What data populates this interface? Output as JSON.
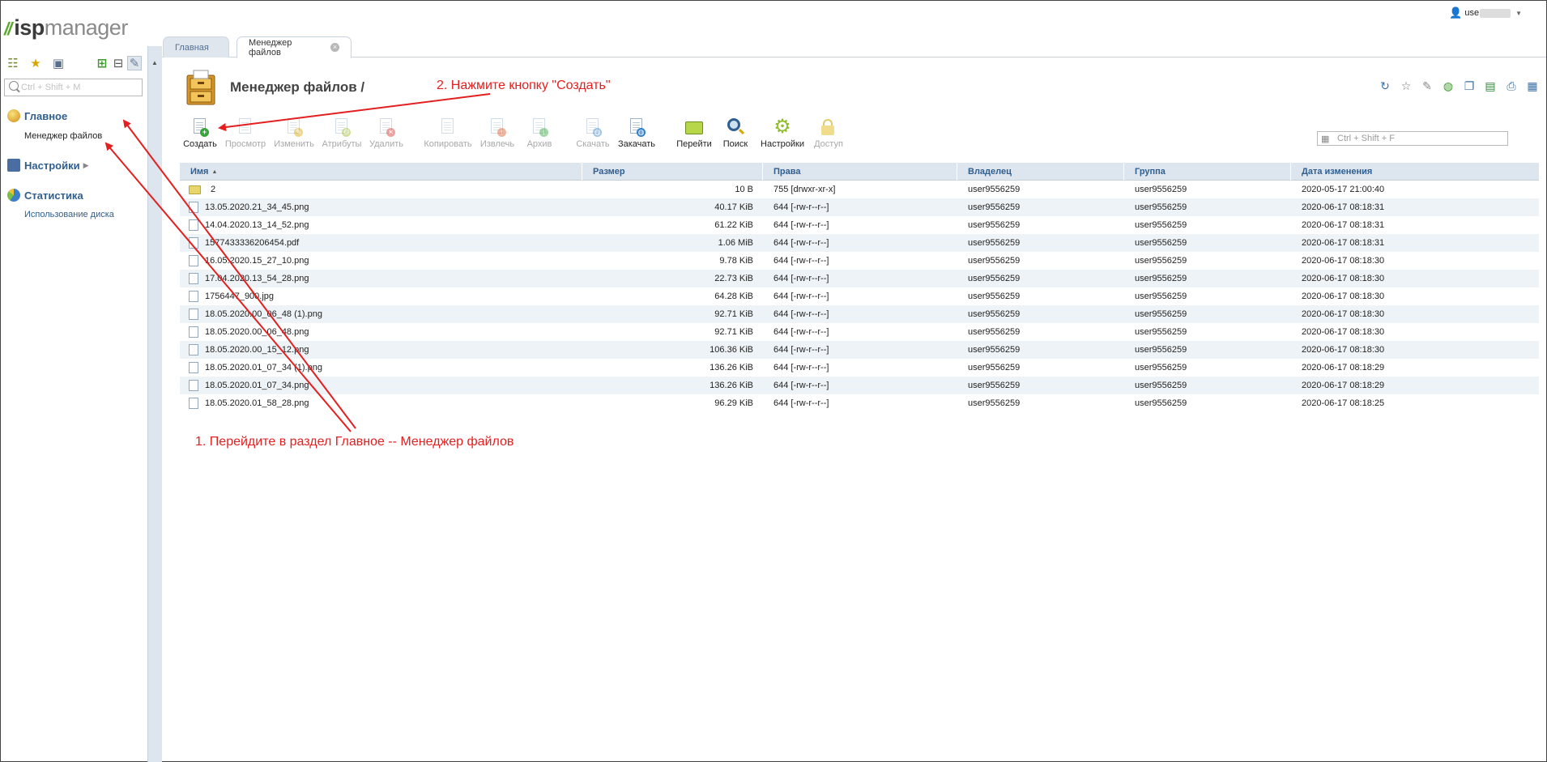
{
  "brand": {
    "slash": "//",
    "isp": "isp",
    "manager": "manager"
  },
  "sidebar": {
    "search_placeholder": "Ctrl + Shift + M",
    "groups": [
      {
        "label": "Главное",
        "items": [
          "Менеджер файлов"
        ]
      },
      {
        "label": "Настройки",
        "items": []
      },
      {
        "label": "Статистика",
        "items": [
          "Использование диска"
        ]
      }
    ]
  },
  "tabs": [
    {
      "label": "Главная"
    },
    {
      "label": "Менеджер файлов"
    }
  ],
  "user": {
    "name": "use"
  },
  "page": {
    "title": "Менеджер файлов /"
  },
  "filter": {
    "placeholder": "Ctrl + Shift + F"
  },
  "toolbar": [
    {
      "label": "Создать",
      "enabled": true,
      "icon": "create-icon"
    },
    {
      "label": "Просмотр",
      "enabled": false,
      "icon": "view-icon"
    },
    {
      "label": "Изменить",
      "enabled": false,
      "icon": "edit-icon"
    },
    {
      "label": "Атрибуты",
      "enabled": false,
      "icon": "attributes-icon"
    },
    {
      "label": "Удалить",
      "enabled": false,
      "icon": "delete-icon"
    },
    {
      "label": "Копировать",
      "enabled": false,
      "icon": "copy-icon"
    },
    {
      "label": "Извлечь",
      "enabled": false,
      "icon": "extract-icon"
    },
    {
      "label": "Архив",
      "enabled": false,
      "icon": "archive-icon"
    },
    {
      "label": "Скачать",
      "enabled": false,
      "icon": "download-icon"
    },
    {
      "label": "Закачать",
      "enabled": true,
      "icon": "upload-icon"
    },
    {
      "label": "Перейти",
      "enabled": true,
      "icon": "folder-go-icon"
    },
    {
      "label": "Поиск",
      "enabled": true,
      "icon": "search-icon"
    },
    {
      "label": "Настройки",
      "enabled": true,
      "icon": "gear-icon"
    },
    {
      "label": "Доступ",
      "enabled": false,
      "icon": "lock-icon"
    }
  ],
  "table": {
    "columns": [
      "Имя",
      "Размер",
      "Права",
      "Владелец",
      "Группа",
      "Дата изменения"
    ],
    "rows": [
      {
        "name": "2",
        "type": "folder",
        "size": "10 B",
        "perm": "755 [drwxr-xr-x]",
        "owner": "user9556259",
        "group": "user9556259",
        "date": "2020-05-17 21:00:40"
      },
      {
        "name": "13.05.2020.21_34_45.png",
        "type": "file",
        "size": "40.17 KiB",
        "perm": "644 [-rw-r--r--]",
        "owner": "user9556259",
        "group": "user9556259",
        "date": "2020-06-17 08:18:31"
      },
      {
        "name": "14.04.2020.13_14_52.png",
        "type": "file",
        "size": "61.22 KiB",
        "perm": "644 [-rw-r--r--]",
        "owner": "user9556259",
        "group": "user9556259",
        "date": "2020-06-17 08:18:31"
      },
      {
        "name": "1577433336206454.pdf",
        "type": "file",
        "size": "1.06 MiB",
        "perm": "644 [-rw-r--r--]",
        "owner": "user9556259",
        "group": "user9556259",
        "date": "2020-06-17 08:18:31"
      },
      {
        "name": "16.05.2020.15_27_10.png",
        "type": "file",
        "size": "9.78 KiB",
        "perm": "644 [-rw-r--r--]",
        "owner": "user9556259",
        "group": "user9556259",
        "date": "2020-06-17 08:18:30"
      },
      {
        "name": "17.04.2020.13_54_28.png",
        "type": "file",
        "size": "22.73 KiB",
        "perm": "644 [-rw-r--r--]",
        "owner": "user9556259",
        "group": "user9556259",
        "date": "2020-06-17 08:18:30"
      },
      {
        "name": "1756447_900.jpg",
        "type": "file",
        "size": "64.28 KiB",
        "perm": "644 [-rw-r--r--]",
        "owner": "user9556259",
        "group": "user9556259",
        "date": "2020-06-17 08:18:30"
      },
      {
        "name": "18.05.2020.00_06_48 (1).png",
        "type": "file",
        "size": "92.71 KiB",
        "perm": "644 [-rw-r--r--]",
        "owner": "user9556259",
        "group": "user9556259",
        "date": "2020-06-17 08:18:30"
      },
      {
        "name": "18.05.2020.00_06_48.png",
        "type": "file",
        "size": "92.71 KiB",
        "perm": "644 [-rw-r--r--]",
        "owner": "user9556259",
        "group": "user9556259",
        "date": "2020-06-17 08:18:30"
      },
      {
        "name": "18.05.2020.00_15_12.png",
        "type": "file",
        "size": "106.36 KiB",
        "perm": "644 [-rw-r--r--]",
        "owner": "user9556259",
        "group": "user9556259",
        "date": "2020-06-17 08:18:30"
      },
      {
        "name": "18.05.2020.01_07_34 (1).png",
        "type": "file",
        "size": "136.26 KiB",
        "perm": "644 [-rw-r--r--]",
        "owner": "user9556259",
        "group": "user9556259",
        "date": "2020-06-17 08:18:29"
      },
      {
        "name": "18.05.2020.01_07_34.png",
        "type": "file",
        "size": "136.26 KiB",
        "perm": "644 [-rw-r--r--]",
        "owner": "user9556259",
        "group": "user9556259",
        "date": "2020-06-17 08:18:29"
      },
      {
        "name": "18.05.2020.01_58_28.png",
        "type": "file",
        "size": "96.29 KiB",
        "perm": "644 [-rw-r--r--]",
        "owner": "user9556259",
        "group": "user9556259",
        "date": "2020-06-17 08:18:25"
      }
    ]
  },
  "annotations": {
    "step1": "1.  Перейдите в раздел Главное --  Менеджер файлов",
    "step2": "2.  Нажмите кнопку \"Создать\""
  },
  "colors": {
    "accent": "#2f5e8f",
    "annotation": "#e41f1f",
    "brand_green": "#5aa82e"
  }
}
